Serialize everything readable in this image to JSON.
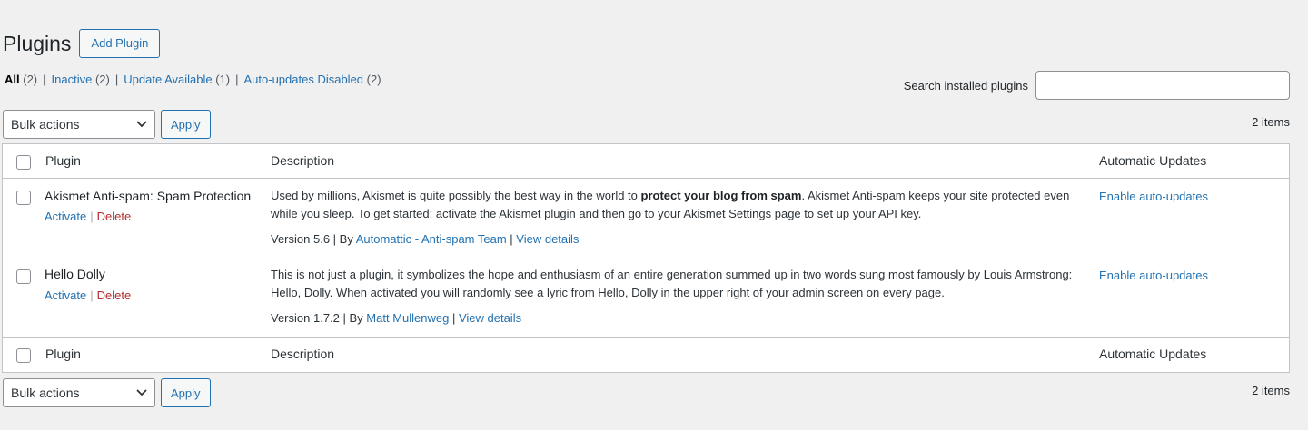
{
  "header": {
    "title": "Plugins",
    "add_button": "Add Plugin"
  },
  "filters": [
    {
      "label": "All",
      "count": "(2)",
      "current": true
    },
    {
      "label": "Inactive",
      "count": "(2)"
    },
    {
      "label": "Update Available",
      "count": "(1)"
    },
    {
      "label": "Auto-updates Disabled",
      "count": "(2)"
    }
  ],
  "search": {
    "label": "Search installed plugins",
    "value": "",
    "placeholder": ""
  },
  "tablenav": {
    "bulk_actions": "Bulk actions",
    "apply": "Apply",
    "items_count": "2 items"
  },
  "columns": {
    "plugin": "Plugin",
    "description": "Description",
    "auto_updates": "Automatic Updates"
  },
  "plugins": [
    {
      "name": "Akismet Anti-spam: Spam Protection",
      "activate": "Activate",
      "delete": "Delete",
      "desc_before": "Used by millions, Akismet is quite possibly the best way in the world to ",
      "desc_bold": "protect your blog from spam",
      "desc_after": ". Akismet Anti-spam keeps your site protected even while you sleep. To get started: activate the Akismet plugin and then go to your Akismet Settings page to set up your API key.",
      "version": "Version 5.6",
      "by": "By",
      "author": "Automattic - Anti-spam Team",
      "view_details": "View details",
      "auto_update": "Enable auto-updates"
    },
    {
      "name": "Hello Dolly",
      "activate": "Activate",
      "delete": "Delete",
      "desc_before": "This is not just a plugin, it symbolizes the hope and enthusiasm of an entire generation summed up in two words sung most famously by Louis Armstrong: Hello, Dolly. When activated you will randomly see a lyric from Hello, Dolly in the upper right of your admin screen on every page.",
      "desc_bold": "",
      "desc_after": "",
      "version": "Version 1.7.2",
      "by": "By",
      "author": "Matt Mullenweg",
      "view_details": "View details",
      "auto_update": "Enable auto-updates"
    }
  ],
  "colors": {
    "link": "#2271b1",
    "delete": "#b32d2e",
    "background": "#f0f0f1"
  }
}
